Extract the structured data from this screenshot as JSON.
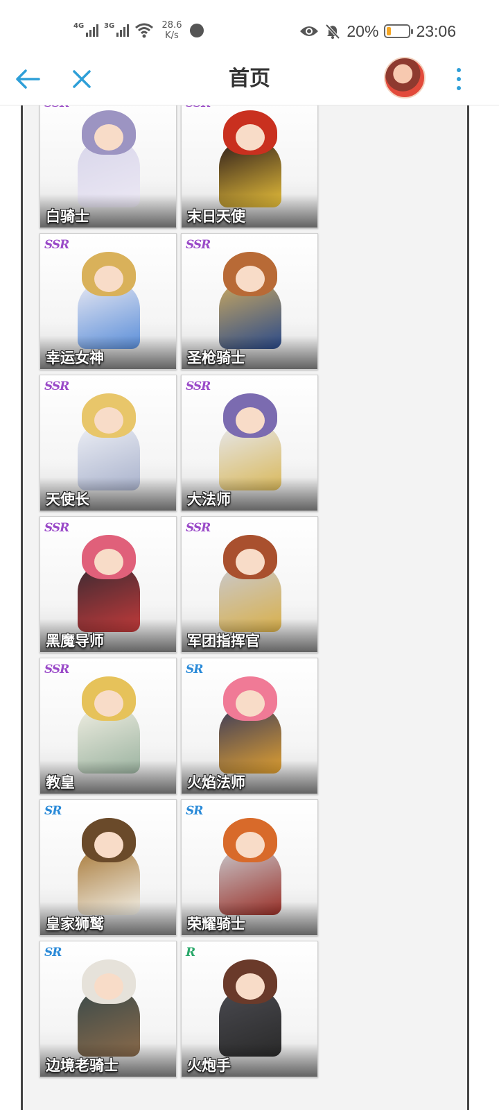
{
  "status_bar": {
    "sim1_tag": "4G",
    "sim2_tag": "3G",
    "net_speed_value": "28.6",
    "net_speed_unit": "K/s",
    "battery_percent": "20%",
    "battery_level": 0.2,
    "time": "23:06",
    "icons": [
      "signal-icon",
      "wifi-icon",
      "globe-icon",
      "eye-icon",
      "mute-bell-icon",
      "battery-icon"
    ],
    "colors": {
      "battery_fill": "#f5a623"
    }
  },
  "app_bar": {
    "title": "首页",
    "icons": {
      "back": "arrow-left-icon",
      "close": "close-icon",
      "more": "more-vertical-icon"
    },
    "accent": "#2e9fd8"
  },
  "characters": [
    {
      "name": "白骑士",
      "rarity": "SSR",
      "palette": [
        "#d8d6ea",
        "#9c94c2",
        "#ece8f4"
      ]
    },
    {
      "name": "末日天使",
      "rarity": "SSR",
      "palette": [
        "#2a1a1a",
        "#c9301f",
        "#e8c03a"
      ]
    },
    {
      "name": "幸运女神",
      "rarity": "SSR",
      "palette": [
        "#e8e8f2",
        "#d9b15a",
        "#5a8ed9"
      ]
    },
    {
      "name": "圣枪骑士",
      "rarity": "SSR",
      "palette": [
        "#c9a860",
        "#b86a36",
        "#2a4a8a"
      ]
    },
    {
      "name": "天使长",
      "rarity": "SSR",
      "palette": [
        "#eef0f6",
        "#e8c66a",
        "#a9b2cc"
      ]
    },
    {
      "name": "大法师",
      "rarity": "SSR",
      "palette": [
        "#e6e8ee",
        "#7b6bb0",
        "#d9b85a"
      ]
    },
    {
      "name": "黑魔导师",
      "rarity": "SSR",
      "palette": [
        "#3a2a32",
        "#e0607a",
        "#c23a3a"
      ]
    },
    {
      "name": "军团指挥官",
      "rarity": "SSR",
      "palette": [
        "#c9c9cf",
        "#a9502e",
        "#d9b04a"
      ]
    },
    {
      "name": "教皇",
      "rarity": "SSR",
      "palette": [
        "#f0eee2",
        "#e6c25a",
        "#9bb3a0"
      ]
    },
    {
      "name": "火焰法师",
      "rarity": "SR",
      "palette": [
        "#3a3a5a",
        "#f07a96",
        "#e0a030"
      ]
    },
    {
      "name": "皇家狮鹫",
      "rarity": "SR",
      "palette": [
        "#a87a3a",
        "#6a4a2a",
        "#f2efe6"
      ]
    },
    {
      "name": "荣耀骑士",
      "rarity": "SR",
      "palette": [
        "#c8c8cc",
        "#d86a2a",
        "#9a3028"
      ]
    },
    {
      "name": "边境老骑士",
      "rarity": "SR",
      "palette": [
        "#3a4a4a",
        "#e6e2da",
        "#8a6a4a"
      ]
    },
    {
      "name": "火炮手",
      "rarity": "R",
      "palette": [
        "#4a4a50",
        "#6a3a2a",
        "#2a2a2a"
      ]
    }
  ],
  "rarity_colors": {
    "SSR": "#9a4ac8",
    "SR": "#2a8ad8",
    "R": "#2aa86a"
  }
}
